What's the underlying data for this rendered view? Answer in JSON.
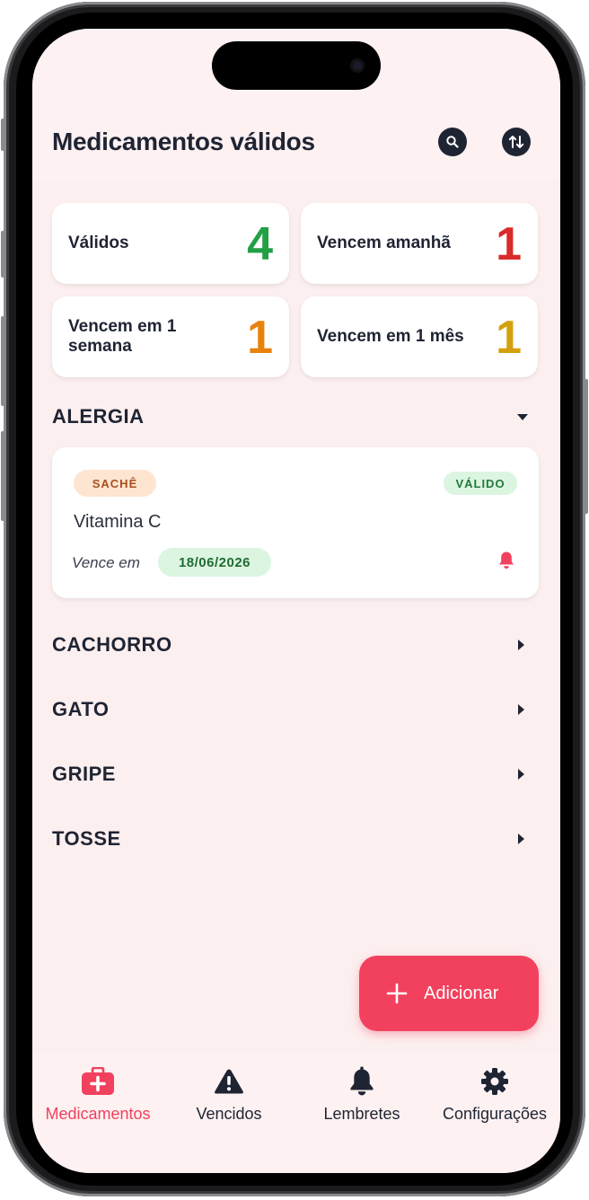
{
  "header": {
    "title": "Medicamentos válidos"
  },
  "stats": [
    {
      "label": "Válidos",
      "value": "4",
      "color": "#22a045"
    },
    {
      "label": "Vencem amanhã",
      "value": "1",
      "color": "#d92b2b"
    },
    {
      "label": "Vencem em 1 semana",
      "value": "1",
      "color": "#e8820c"
    },
    {
      "label": "Vencem em 1 mês",
      "value": "1",
      "color": "#d4a00e"
    }
  ],
  "groups": [
    {
      "name": "ALERGIA",
      "expanded": true
    },
    {
      "name": "CACHORRO",
      "expanded": false
    },
    {
      "name": "GATO",
      "expanded": false
    },
    {
      "name": "GRIPE",
      "expanded": false
    },
    {
      "name": "TOSSE",
      "expanded": false
    }
  ],
  "medicine": {
    "type": "SACHÊ",
    "status": "VÁLIDO",
    "name": "Vitamina C",
    "expires_label": "Vence em",
    "expires_date": "18/06/2026"
  },
  "fab": {
    "label": "Adicionar"
  },
  "nav": [
    {
      "label": "Medicamentos",
      "icon": "medical-kit-icon",
      "active": true
    },
    {
      "label": "Vencidos",
      "icon": "warning-icon",
      "active": false
    },
    {
      "label": "Lembretes",
      "icon": "bell-icon",
      "active": false
    },
    {
      "label": "Configurações",
      "icon": "gear-icon",
      "active": false
    }
  ],
  "colors": {
    "accent": "#f2415e",
    "text": "#1f2433",
    "background": "#fcefef"
  }
}
